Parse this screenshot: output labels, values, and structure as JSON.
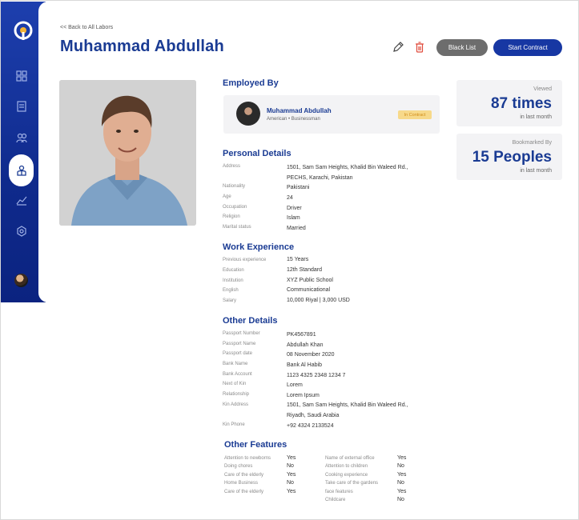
{
  "header": {
    "back_link": "<< Back to All Labors",
    "title": "Muhammad Abdullah",
    "black_list": "Black List",
    "start_contract": "Start Contract"
  },
  "stats": {
    "viewed_label": "Viewed",
    "viewed_value": "87 times",
    "viewed_sub": "in last month",
    "bookmarked_label": "Bookmarked By",
    "bookmarked_value": "15 Peoples",
    "bookmarked_sub": "in last month"
  },
  "employed_by": {
    "title": "Employed By",
    "name": "Muhammad Abdullah",
    "meta": "American  •  Businessman",
    "badge": "In Contract"
  },
  "personal": {
    "title": "Personal Details",
    "rows": [
      {
        "label": "Address",
        "value": "1501, Sam Sam Heights, Khalid Bin Waleed Rd.,",
        "value2": "PECHS, Karachi, Pakistan"
      },
      {
        "label": "Nationality",
        "value": "Pakistani"
      },
      {
        "label": "Age",
        "value": "24"
      },
      {
        "label": "Occupation",
        "value": "Driver"
      },
      {
        "label": "Religion",
        "value": "Islam"
      },
      {
        "label": "Marital status",
        "value": "Married"
      }
    ]
  },
  "work": {
    "title": "Work Experience",
    "rows": [
      {
        "label": "Previous experience",
        "value": "15 Years"
      },
      {
        "label": "Education",
        "value": "12th Standard"
      },
      {
        "label": "Institution",
        "value": "XYZ Public School"
      },
      {
        "label": "English",
        "value": "Communicational"
      },
      {
        "label": "Salary",
        "value": "10,000 Riyal  |  3,000 USD"
      }
    ]
  },
  "other": {
    "title": "Other Details",
    "rows": [
      {
        "label": "Passport Number",
        "value": "PK4567891"
      },
      {
        "label": "Passport Name",
        "value": "Abdullah Khan"
      },
      {
        "label": "Passport date",
        "value": "08 November 2020"
      },
      {
        "label": "Bank Name",
        "value": "Bank Al Habib"
      },
      {
        "label": "Bank Account",
        "value": "1123 4325 2348 1234 7"
      },
      {
        "label": "Next of Kin",
        "value": "Lorem"
      },
      {
        "label": "Relationship",
        "value": "Lorem Ipsum"
      },
      {
        "label": "Kin Address",
        "value": "1501, Sam Sam Heights, Khalid Bin Waleed Rd.,",
        "value2": "Riyadh, Saudi Arabia"
      },
      {
        "label": "Kin Phone",
        "value": "+92 4324 2133524"
      }
    ]
  },
  "features": {
    "title": "Other Features",
    "left": [
      {
        "label": "Attention to newborns",
        "value": "Yes"
      },
      {
        "label": "Doing chores",
        "value": "No"
      },
      {
        "label": "Care of the elderly",
        "value": "Yes"
      },
      {
        "label": "Home Business",
        "value": "No"
      },
      {
        "label": "Care of the elderly",
        "value": "Yes"
      }
    ],
    "right": [
      {
        "label": "Name of external office",
        "value": "Yes"
      },
      {
        "label": "Attention to children",
        "value": "No"
      },
      {
        "label": "Cooking experience",
        "value": "Yes"
      },
      {
        "label": "Take care of the gardens",
        "value": "No"
      },
      {
        "label": "face features",
        "value": "Yes"
      },
      {
        "label": "Childcare",
        "value": "No"
      }
    ]
  },
  "icons": {
    "logo": "brand-logo-icon",
    "nav": [
      "dashboard-icon",
      "document-icon",
      "users-icon",
      "labor-icon",
      "analytics-icon",
      "settings-icon"
    ],
    "edit": "pencil-icon",
    "delete": "trash-icon"
  },
  "colors": {
    "primary": "#1a3b93",
    "sidebar": "#1237a0",
    "black_list_button": "#6d6d6d",
    "start_contract_button": "#1737a3",
    "badge_bg": "#f7d98a",
    "badge_text": "#d08c1a",
    "delete_icon": "#e04b3c"
  }
}
